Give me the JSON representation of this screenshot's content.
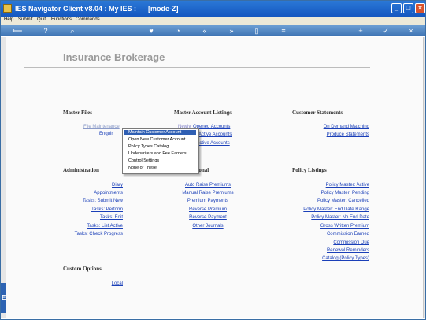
{
  "window": {
    "title": "IES Navigator Client v8.04 : My IES :      [mode-Z]"
  },
  "menu": {
    "items": [
      "Help",
      "Submit",
      "Quit",
      "Functions",
      "Commands"
    ]
  },
  "page": {
    "title": "Insurance Brokerage"
  },
  "sections": {
    "master_files": "Master Files",
    "master_account_listings": "Master Account Listings",
    "customer_statements": "Customer Statements",
    "administration": "Administration",
    "transactional": "ctional",
    "policy_listings": "Policy Listings",
    "custom_options": "Custom Options"
  },
  "master_files": {
    "file_maintenance": "File Maintenance",
    "enquiry": "Enquir"
  },
  "master_account_listings": {
    "opened_prefix": "Newly",
    "opened": "Opened Accounts",
    "active": "Active Accounts",
    "inactive": "Inactive Accounts"
  },
  "customer_statements": {
    "on_demand": "On Demand Matching",
    "produce": "Produce Statements"
  },
  "administration": [
    "Diary",
    "Appointments",
    "Tasks: Submit New",
    "Tasks: Perform",
    "Tasks: Edit",
    "Tasks: List Active",
    "Tasks: Check Progress"
  ],
  "transactional": [
    "Auto Raise Premiums",
    "Manual Raise Premiums",
    "Premium Payments",
    "Reverse Premium",
    "Reverse Payment",
    "Other Journals"
  ],
  "policy_listings": [
    "Policy Master: Active",
    "Policy Master: Pending",
    "Policy Master: Cancelled",
    "Policy Master: End Date Range",
    "Policy Master: No End Date",
    "Gross Written Premium",
    "Commission Earned",
    "Commission Due",
    "Renewal Reminders",
    "Catalog (Policy Types)"
  ],
  "custom_options": {
    "local": "Local"
  },
  "popup_menu": {
    "selected_index": 0,
    "items": [
      "Maintain Customer Account",
      "Open New Customer Account",
      "Policy Types Catalog",
      "Underwriters and Fee Earners",
      "Control Settings",
      "None of These"
    ]
  },
  "icons": {
    "toolbar": [
      "back-arrow-icon",
      "help-icon",
      "search-icon",
      "heart-icon",
      "clock-icon",
      "rewind-icon",
      "fast-forward-icon",
      "page-icon",
      "menu-icon",
      "add-icon",
      "check-icon",
      "close-icon"
    ]
  },
  "colors": {
    "titlebar": "#1457c0",
    "link": "#1a3fb8",
    "popup_selected": "#2f5fb3"
  }
}
